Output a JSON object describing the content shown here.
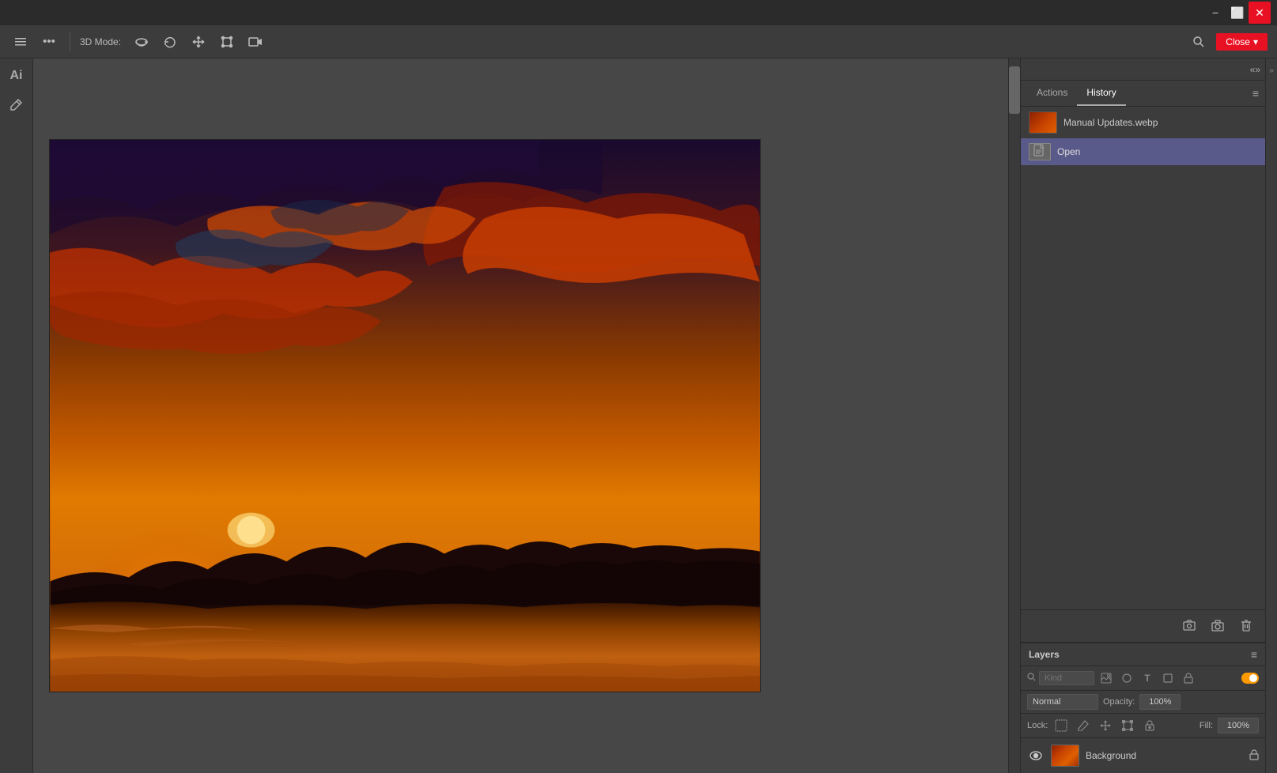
{
  "titlebar": {
    "minimize_label": "−",
    "maximize_label": "⬜",
    "close_label": "✕"
  },
  "toolbar": {
    "mode_label": "3D Mode:",
    "more_label": "•••",
    "close_button_label": "Close",
    "chevron_label": "▾"
  },
  "panel": {
    "collapse_arrow": "«»",
    "tabs": [
      {
        "id": "actions",
        "label": "Actions"
      },
      {
        "id": "history",
        "label": "History"
      }
    ],
    "active_tab": "history",
    "menu_icon": "≡",
    "history_items": [
      {
        "id": "file-item",
        "filename": "Manual Updates.webp",
        "has_thumbnail": true
      }
    ],
    "history_actions": [
      {
        "id": "open",
        "label": "Open"
      }
    ],
    "bottom_buttons": [
      {
        "id": "snapshot",
        "icon": "📸"
      },
      {
        "id": "camera",
        "icon": "📷"
      },
      {
        "id": "trash",
        "icon": "🗑"
      }
    ]
  },
  "layers": {
    "title": "Layers",
    "menu_icon": "≡",
    "filter": {
      "search_icon": "🔍",
      "kind_placeholder": "Kind",
      "filter_icons": [
        "🖼",
        "⬛",
        "T",
        "□",
        "🔒"
      ]
    },
    "blend_mode": "Normal",
    "opacity_label": "Opacity:",
    "opacity_value": "100%",
    "lock_label": "Lock:",
    "fill_label": "Fill:",
    "fill_value": "100%",
    "items": [
      {
        "id": "background",
        "name": "Background",
        "visible": true,
        "locked": true,
        "has_thumbnail": true
      }
    ]
  },
  "icons": {
    "collapse": "«",
    "expand": "»",
    "eye": "👁",
    "lock": "🔒",
    "brush": "✏",
    "move": "✥",
    "transform": "⊹",
    "video": "▶",
    "rotate": "↺",
    "reset": "↻",
    "search": "🔍",
    "ai": "Ai",
    "image_filter": "🖼",
    "circle_filter": "⬛",
    "text_filter": "T",
    "shape_filter": "▭",
    "lock_filter": "🔒",
    "new_layer": "📄",
    "camera_icon": "📷",
    "trash_icon": "🗑",
    "snapshot_icon": "📸"
  }
}
